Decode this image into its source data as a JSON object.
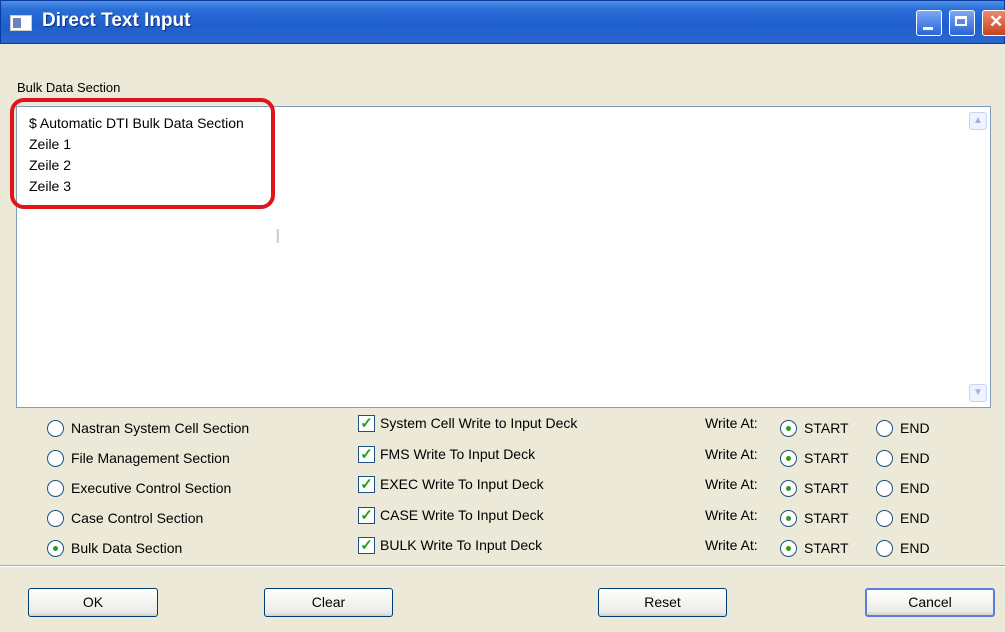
{
  "window": {
    "title": "Direct Text Input"
  },
  "section_label": "Bulk Data Section",
  "editor": {
    "lines": [
      "$ Automatic DTI Bulk Data Section",
      "Zeile 1",
      "Zeile 2",
      "Zeile 3"
    ]
  },
  "sections": [
    {
      "radio_label": "Nastran System Cell Section",
      "selected": false,
      "check_label": "System Cell Write to Input Deck",
      "checked": true,
      "write_at": "START"
    },
    {
      "radio_label": "File Management Section",
      "selected": false,
      "check_label": "FMS Write To Input Deck",
      "checked": true,
      "write_at": "START"
    },
    {
      "radio_label": "Executive Control Section",
      "selected": false,
      "check_label": "EXEC Write To Input Deck",
      "checked": true,
      "write_at": "START"
    },
    {
      "radio_label": "Case Control Section",
      "selected": false,
      "check_label": "CASE Write To Input Deck",
      "checked": true,
      "write_at": "START"
    },
    {
      "radio_label": "Bulk Data Section",
      "selected": true,
      "check_label": "BULK Write To Input Deck",
      "checked": true,
      "write_at": "START"
    }
  ],
  "write_at_label": "Write At:",
  "start_label": "START",
  "end_label": "END",
  "buttons": {
    "ok": "OK",
    "clear": "Clear",
    "reset": "Reset",
    "cancel": "Cancel"
  },
  "colors": {
    "titlebar": "#1f5fcd",
    "highlight": "#e0141b",
    "dialog_bg": "#ece9d8"
  }
}
